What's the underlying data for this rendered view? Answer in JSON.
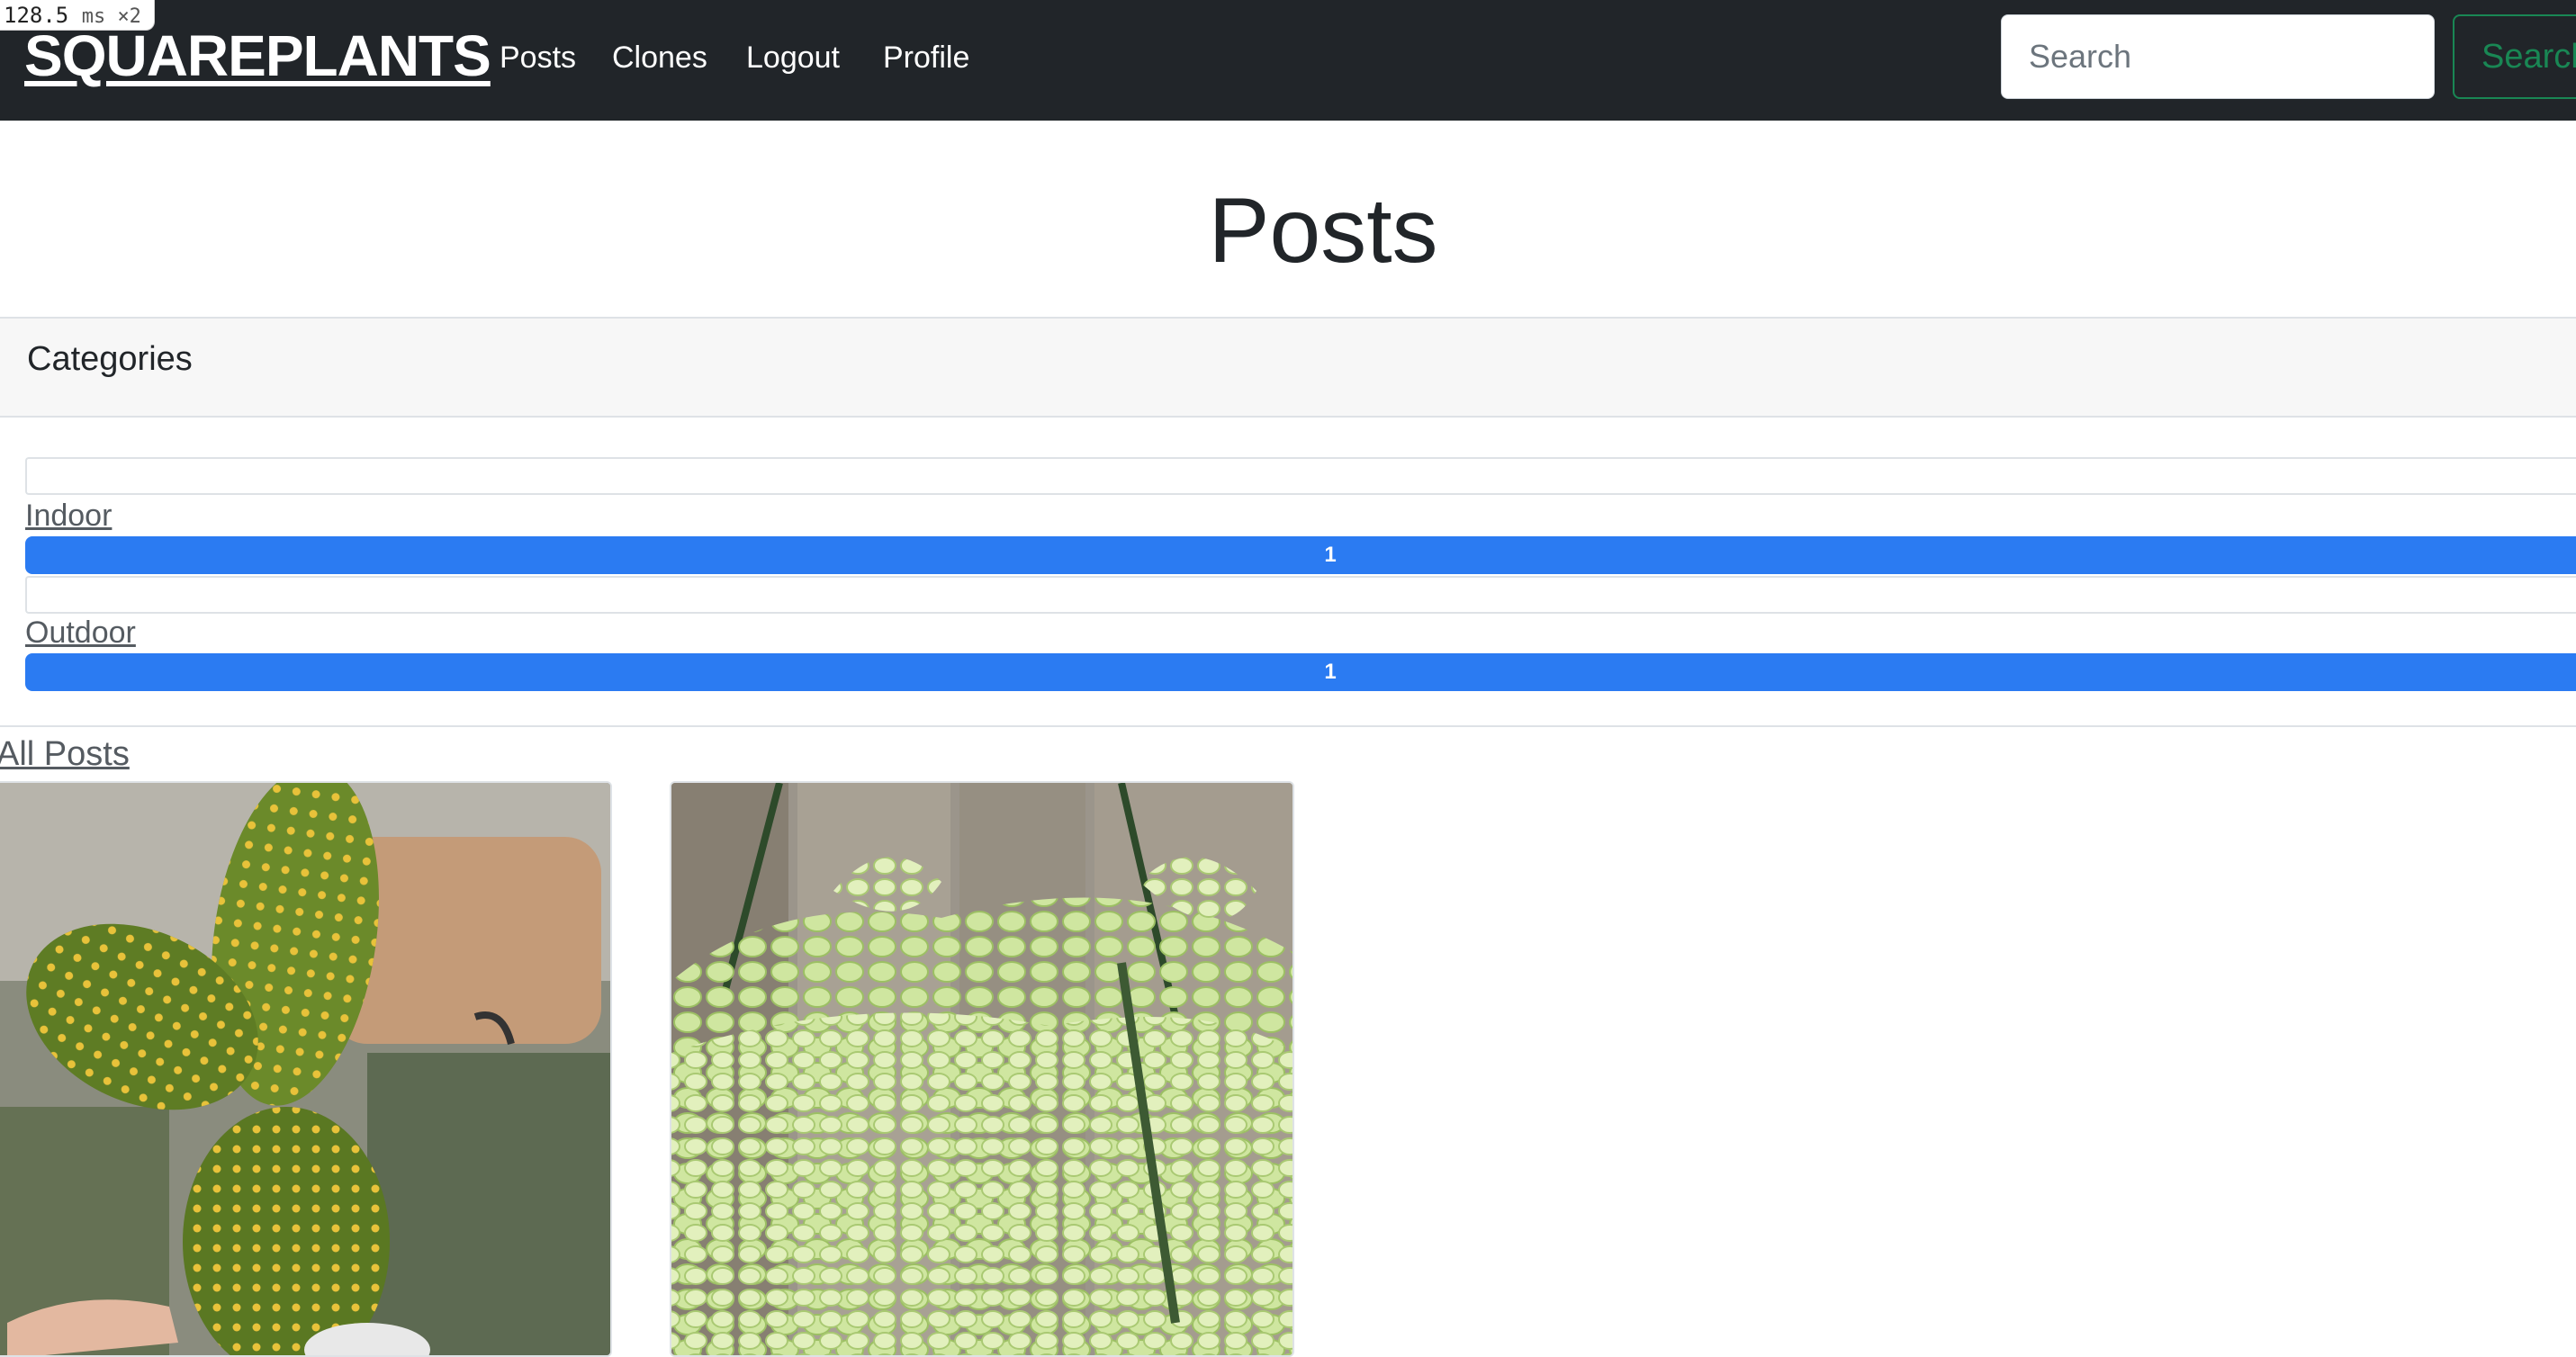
{
  "perf_overlay": {
    "value": "128.5",
    "unit": "ms ×2"
  },
  "navbar": {
    "brand": "SQUAREPLANTS",
    "links": [
      "Posts",
      "Clones",
      "Logout",
      "Profile"
    ],
    "search": {
      "placeholder": "Search",
      "button_label": "Search"
    }
  },
  "page": {
    "title": "Posts"
  },
  "categories": {
    "header": "Categories",
    "items": [
      {
        "name": "Indoor",
        "count": "1",
        "fill_fraction": 1.0
      },
      {
        "name": "Outdoor",
        "count": "1",
        "fill_fraction": 1.0
      }
    ]
  },
  "all_posts_link": "All Posts",
  "posts": [
    {
      "image_subject": "bunny-ear-cactus"
    },
    {
      "image_subject": "burros-tail-succulent"
    }
  ],
  "colors": {
    "navbar_bg": "#212529",
    "progress_bar": "#2b7bf2",
    "search_button_outline": "#198754"
  }
}
